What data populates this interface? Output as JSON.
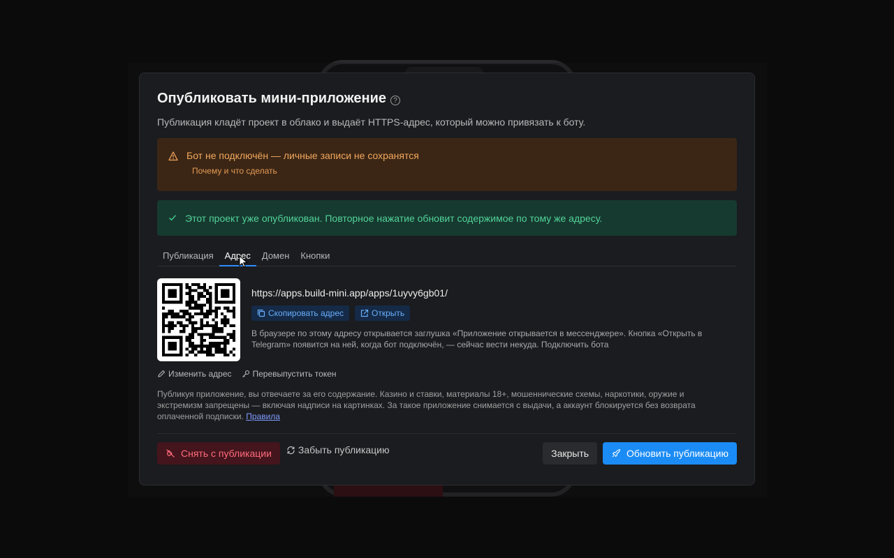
{
  "modal": {
    "title": "Опубликовать мини-приложение",
    "help_icon": "question-circle-icon",
    "subtitle": "Публикация кладёт проект в облако и выдаёт HTTPS-адрес, который можно привязать к боту."
  },
  "warning": {
    "title": "Бот не подключён — личные записи не сохранятся",
    "link": "Почему и что сделать",
    "icon": "warning-triangle-icon",
    "color": "#f2a85e"
  },
  "success": {
    "text": "Этот проект уже опубликован. Повторное нажатие обновит содержимое по тому же адресу.",
    "icon": "check-icon",
    "color": "#52d399"
  },
  "tabs": [
    {
      "label": "Публикация",
      "active": false
    },
    {
      "label": "Адрес",
      "active": true
    },
    {
      "label": "Домен",
      "active": false
    },
    {
      "label": "Кнопки",
      "active": false
    }
  ],
  "address": {
    "url": "https://apps.build-mini.app/apps/1uyvy6gb01/",
    "copy_label": "Скопировать адрес",
    "open_label": "Открыть",
    "note": "В браузере по этому адресу открывается заглушка «Приложение открывается в мессенджере». Кнопка «Открыть в Telegram» появится на ней, когда бот подключён, — сейчас вести некуда. Подключить бота"
  },
  "actions": {
    "edit_address": "Изменить адрес",
    "reissue_token": "Перевыпустить токен"
  },
  "legal": {
    "text": "Публикуя приложение, вы отвечаете за его содержание. Казино и ставки, материалы 18+, мошеннические схемы, наркотики, оружие и экстремизм запрещены — включая надписи на картинках. За такое приложение снимается с выдачи, а аккаунт блокируется без возврата оплаченной подписки.",
    "link": "Правила"
  },
  "footer": {
    "unpublish": "Снять с публикации",
    "forget": "Забыть публикацию",
    "close": "Закрыть",
    "update": "Обновить публикацию"
  },
  "colors": {
    "accent": "#1b8cf5",
    "danger": "#ff6b7d"
  }
}
